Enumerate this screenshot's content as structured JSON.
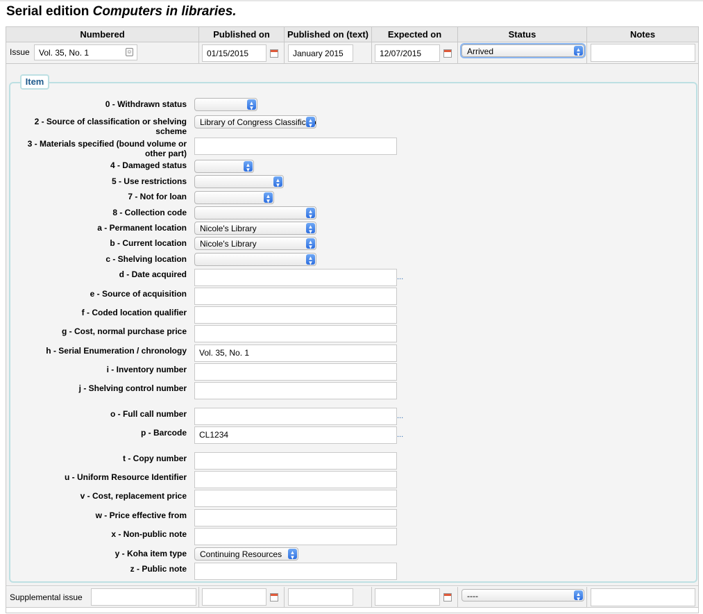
{
  "page": {
    "title_prefix": "Serial edition ",
    "title_name": "Computers in libraries."
  },
  "table": {
    "headers": [
      "Numbered",
      "Published on",
      "Published on (text)",
      "Expected on",
      "Status",
      "Notes"
    ],
    "issue": {
      "label": "Issue",
      "numbered": "Vol. 35, No. 1",
      "published_on": "01/15/2015",
      "published_text": "January 2015",
      "expected_on": "12/07/2015",
      "status": "Arrived",
      "notes": ""
    },
    "supplemental": {
      "label": "Supplemental issue",
      "status": "----"
    }
  },
  "item": {
    "legend": "Item",
    "fields": [
      {
        "label": "0 - Withdrawn status",
        "value": ""
      },
      {
        "label": "2 - Source of classification or shelving scheme",
        "value": "Library of Congress Classification"
      },
      {
        "label": "3 - Materials specified (bound volume or other part)",
        "value": ""
      },
      {
        "label": "4 - Damaged status",
        "value": ""
      },
      {
        "label": "5 - Use restrictions",
        "value": ""
      },
      {
        "label": "7 - Not for loan",
        "value": ""
      },
      {
        "label": "8 - Collection code",
        "value": ""
      },
      {
        "label": "a - Permanent location",
        "value": "Nicole's Library"
      },
      {
        "label": "b - Current location",
        "value": "Nicole's Library"
      },
      {
        "label": "c - Shelving location",
        "value": ""
      },
      {
        "label": "d - Date acquired",
        "value": "",
        "extra": "..."
      },
      {
        "label": "e - Source of acquisition",
        "value": ""
      },
      {
        "label": "f - Coded location qualifier",
        "value": ""
      },
      {
        "label": "g - Cost, normal purchase price",
        "value": ""
      },
      {
        "label": "h - Serial Enumeration / chronology",
        "value": "Vol. 35, No. 1"
      },
      {
        "label": "i - Inventory number",
        "value": ""
      },
      {
        "label": "j - Shelving control number",
        "value": ""
      },
      {
        "label": "o - Full call number",
        "value": "",
        "extra": "..."
      },
      {
        "label": "p - Barcode",
        "value": "CL1234",
        "extra": "..."
      },
      {
        "label": "t - Copy number",
        "value": ""
      },
      {
        "label": "u - Uniform Resource Identifier",
        "value": ""
      },
      {
        "label": "v - Cost, replacement price",
        "value": ""
      },
      {
        "label": "w - Price effective from",
        "value": ""
      },
      {
        "label": "x - Non-public note",
        "value": ""
      },
      {
        "label": "y - Koha item type",
        "value": "Continuing Resources"
      },
      {
        "label": "z - Public note",
        "value": ""
      }
    ]
  },
  "icons": {
    "calendar": "calendar-icon",
    "contact": "contact-card-icon",
    "select": "select-arrows-icon"
  },
  "colors": {
    "legend_text": "#1e5a8c",
    "fieldset_border": "#bde0e3",
    "select_arrow": "#2e6fe0",
    "link_dots": "#2466b1"
  }
}
